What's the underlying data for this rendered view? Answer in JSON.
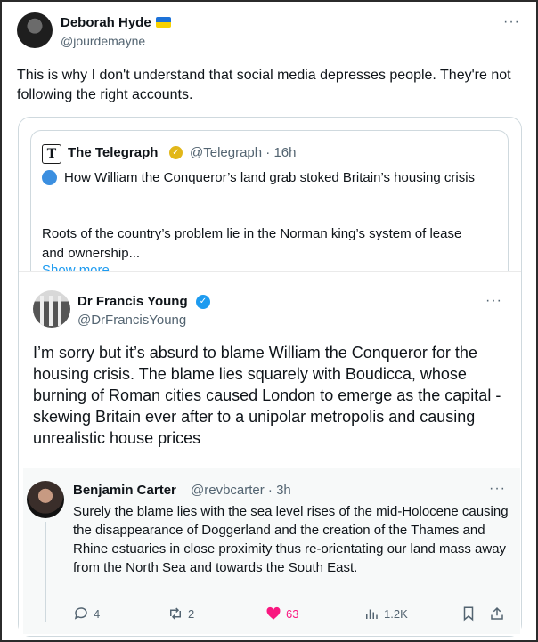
{
  "outer": {
    "name": "Deborah Hyde",
    "handle": "@jourdemayne",
    "more": "···",
    "text": "This is why I don't understand that social media depresses people. They're not following the right accounts."
  },
  "quoted": {
    "logo": "T",
    "name": "The Telegraph",
    "handle": "@Telegraph · 16h",
    "headline": "How William the Conqueror’s land grab stoked Britain’s housing crisis",
    "body": "Roots of the country’s problem lie in the Norman king’s system of lease and ownership...",
    "show_more": "Show more"
  },
  "francis": {
    "name": "Dr Francis Young",
    "handle": "@DrFrancisYoung",
    "more": "···",
    "text": "I’m sorry but it’s absurd to blame William the Conqueror for the housing crisis. The blame lies squarely with Boudicca, whose burning of Roman cities caused London to emerge as the capital - skewing Britain ever after to a unipolar metropolis and causing unrealistic house prices"
  },
  "reply": {
    "name": "Benjamin Carter",
    "handle": "@revbcarter · 3h",
    "more": "···",
    "text": "Surely the blame lies with the sea level rises of the mid-Holocene causing the disappearance of Doggerland and the creation of the Thames and Rhine estuaries in close proximity thus re-orientating our land mass away from the North Sea and towards the South East.",
    "actions": {
      "replies": "4",
      "retweets": "2",
      "likes": "63",
      "views": "1.2K"
    }
  },
  "colors": {
    "accent": "#1d9bf0",
    "like": "#f91880",
    "muted": "#536471",
    "flag_blue": "#1d72d8",
    "flag_yellow": "#f7d100"
  }
}
